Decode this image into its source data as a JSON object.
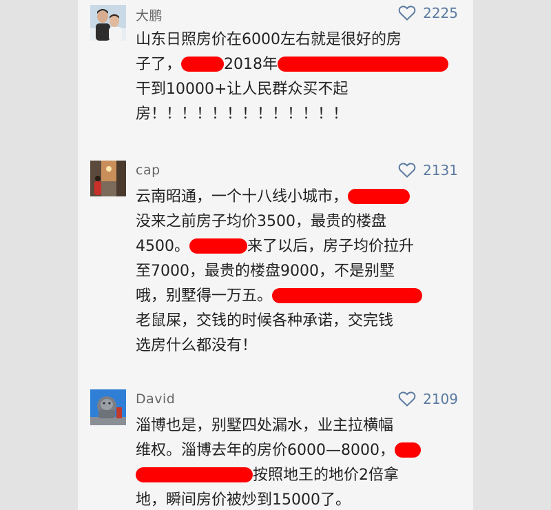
{
  "colors": {
    "gutter": "#e3e3e3",
    "feed_background": "#f5f5f5",
    "username": "#666666",
    "like_accent": "#5a7aa0",
    "comment_text": "#222222",
    "redaction": "#ff0000"
  },
  "comments": [
    {
      "username": "大鹏",
      "likes": "2225",
      "lines": [
        [
          "山东日照房价在6000左右就是很好的房"
        ],
        [
          "子了，",
          "2018年"
        ],
        [
          "干到10000+让人民群众买不起"
        ],
        [
          "房！！！！！！！！！！！！！"
        ]
      ]
    },
    {
      "username": "cap",
      "likes": "2131",
      "lines": [
        [
          "云南昭通，一个十八线小城市，"
        ],
        [
          "没来之前房子均价3500，最贵的楼盘"
        ],
        [
          "4500。",
          "来了以后，房子均价拉升"
        ],
        [
          "至7000，最贵的楼盘9000，不是别墅"
        ],
        [
          "哦，别墅得一万五。"
        ],
        [
          "老鼠屎，交钱的时候各种承诺，交完钱"
        ],
        [
          "选房什么都没有！"
        ]
      ]
    },
    {
      "username": "David",
      "likes": "2109",
      "lines": [
        [
          "淄博也是，别墅四处漏水，业主拉横幅"
        ],
        [
          "维权。淄博去年的房价6000—8000，"
        ],
        [
          "按照地王的地价2倍拿"
        ],
        [
          "地，瞬间房价被炒到15000了。"
        ]
      ]
    }
  ]
}
